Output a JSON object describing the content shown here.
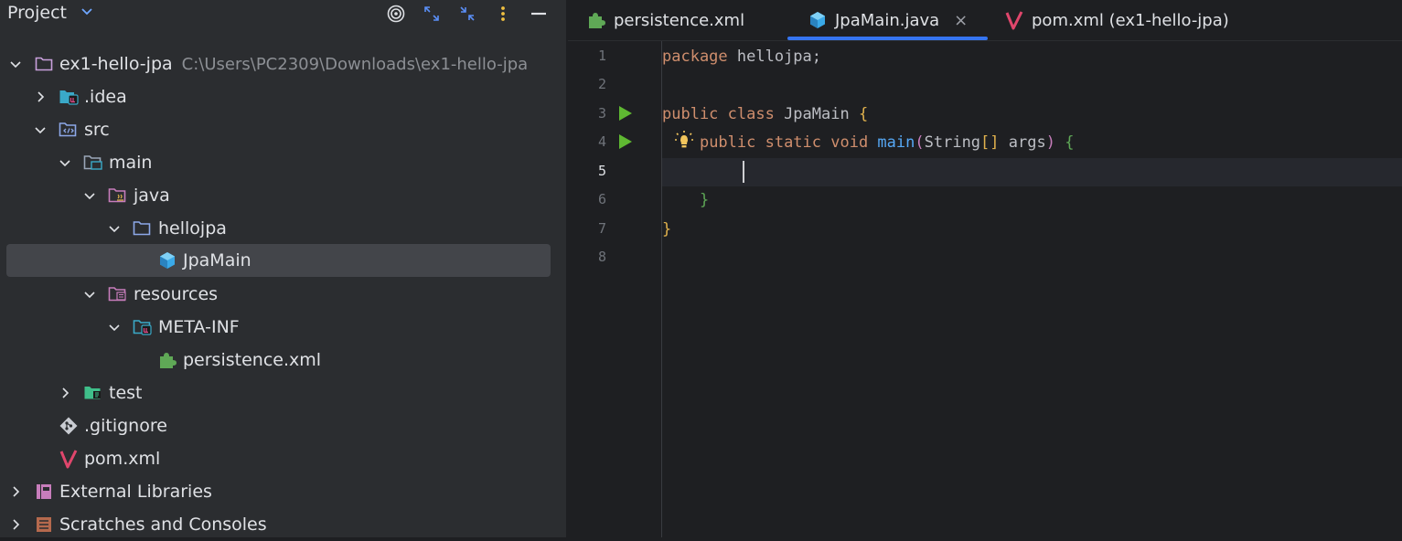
{
  "project_panel": {
    "title": "Project",
    "tree": [
      {
        "label": "ex1-hello-jpa",
        "path": "C:\\Users\\PC2309\\Downloads\\ex1-hello-jpa"
      },
      {
        "label": ".idea"
      },
      {
        "label": "src"
      },
      {
        "label": "main"
      },
      {
        "label": "java"
      },
      {
        "label": "hellojpa"
      },
      {
        "label": "JpaMain"
      },
      {
        "label": "resources"
      },
      {
        "label": "META-INF"
      },
      {
        "label": "persistence.xml"
      },
      {
        "label": "test"
      },
      {
        "label": ".gitignore"
      },
      {
        "label": "pom.xml"
      },
      {
        "label": "External Libraries"
      },
      {
        "label": "Scratches and Consoles"
      }
    ]
  },
  "tabs": [
    {
      "label": "persistence.xml"
    },
    {
      "label": "JpaMain.java",
      "close": "×"
    },
    {
      "label": "pom.xml (ex1-hello-jpa)"
    }
  ],
  "editor": {
    "line_numbers": [
      "1",
      "2",
      "3",
      "4",
      "5",
      "6",
      "7",
      "8"
    ],
    "code": {
      "l1_kw": "package",
      "l1_rest": " hellojpa;",
      "l3_kw": "public class",
      "l3_name": " JpaMain ",
      "l3_brace": "{",
      "l4_indent": "    ",
      "l4_kw": "public static void",
      "l4_fn": " main",
      "l4_paren_open": "(",
      "l4_type": "String",
      "l4_brackets": "[]",
      "l4_arg": " args",
      "l4_paren_close": ")",
      "l4_brace": " {",
      "l6_indent": "    ",
      "l6_brace": "}",
      "l7_brace": "}"
    }
  },
  "colors": {
    "accent": "#3574f0",
    "run": "#5fb832",
    "keyword": "#cf8e6d",
    "function": "#56a8f5"
  }
}
